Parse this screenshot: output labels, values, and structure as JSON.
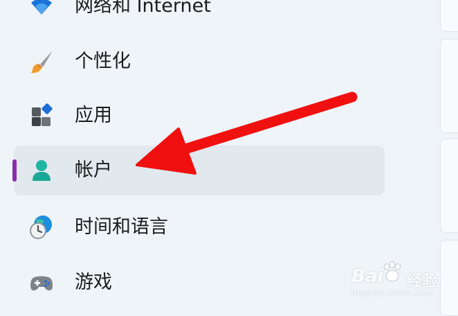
{
  "nav": {
    "items": [
      {
        "label": "网络和 Internet",
        "icon": "wifi-icon",
        "selected": false
      },
      {
        "label": "个性化",
        "icon": "paintbrush-icon",
        "selected": false
      },
      {
        "label": "应用",
        "icon": "apps-icon",
        "selected": false
      },
      {
        "label": "帐户",
        "icon": "account-person-icon",
        "selected": true
      },
      {
        "label": "时间和语言",
        "icon": "time-language-icon",
        "selected": false
      },
      {
        "label": "游戏",
        "icon": "gamepad-icon",
        "selected": false
      }
    ]
  },
  "annotation": {
    "type": "arrow",
    "color": "#f01010",
    "points_to": "帐户"
  },
  "watermark": {
    "brand": "Bai",
    "brand_cn": "经验",
    "url": "jingyan.baidu.com"
  },
  "colors": {
    "selection_indicator": "#8a2bb0",
    "selected_background": "#e1e9ee",
    "background": "#eef4f8"
  }
}
